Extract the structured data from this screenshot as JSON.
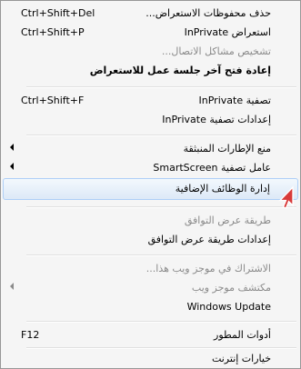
{
  "menu": {
    "items": [
      {
        "label": "حذف محفوظات الاستعراض...",
        "shortcut": "Ctrl+Shift+Del"
      },
      {
        "label": "استعراض InPrivate",
        "shortcut": "Ctrl+Shift+P"
      },
      {
        "label": "تشخيص مشاكل الاتصال..."
      },
      {
        "label": "إعادة فتح آخر جلسة عمل للاستعراض"
      },
      {
        "label": "تصفية InPrivate",
        "shortcut": "Ctrl+Shift+F"
      },
      {
        "label": "إعدادات تصفية InPrivate"
      },
      {
        "label": "منع الإطارات المنبثقة"
      },
      {
        "label": "عامل تصفية SmartScreen"
      },
      {
        "label": "إدارة الوظائف الإضافية"
      },
      {
        "label": "طريقة عرض التوافق"
      },
      {
        "label": "إعدادات طريقة عرض التوافق"
      },
      {
        "label": "الاشتراك في موجز ويب هذا..."
      },
      {
        "label": "مكتشف موجز ويب"
      },
      {
        "label": "Windows Update"
      },
      {
        "label": "أدوات المطور",
        "shortcut": "F12"
      },
      {
        "label": "خيارات إنترنت"
      }
    ]
  },
  "icons": {
    "submenu_arrow": "chevron-left-icon",
    "cursor": "mouse-pointer-icon"
  },
  "colors": {
    "background": "#f5f5f5",
    "disabled_text": "#8a8a8a",
    "hover_border": "#aecff7",
    "hover_fill": "#dde9f7"
  }
}
